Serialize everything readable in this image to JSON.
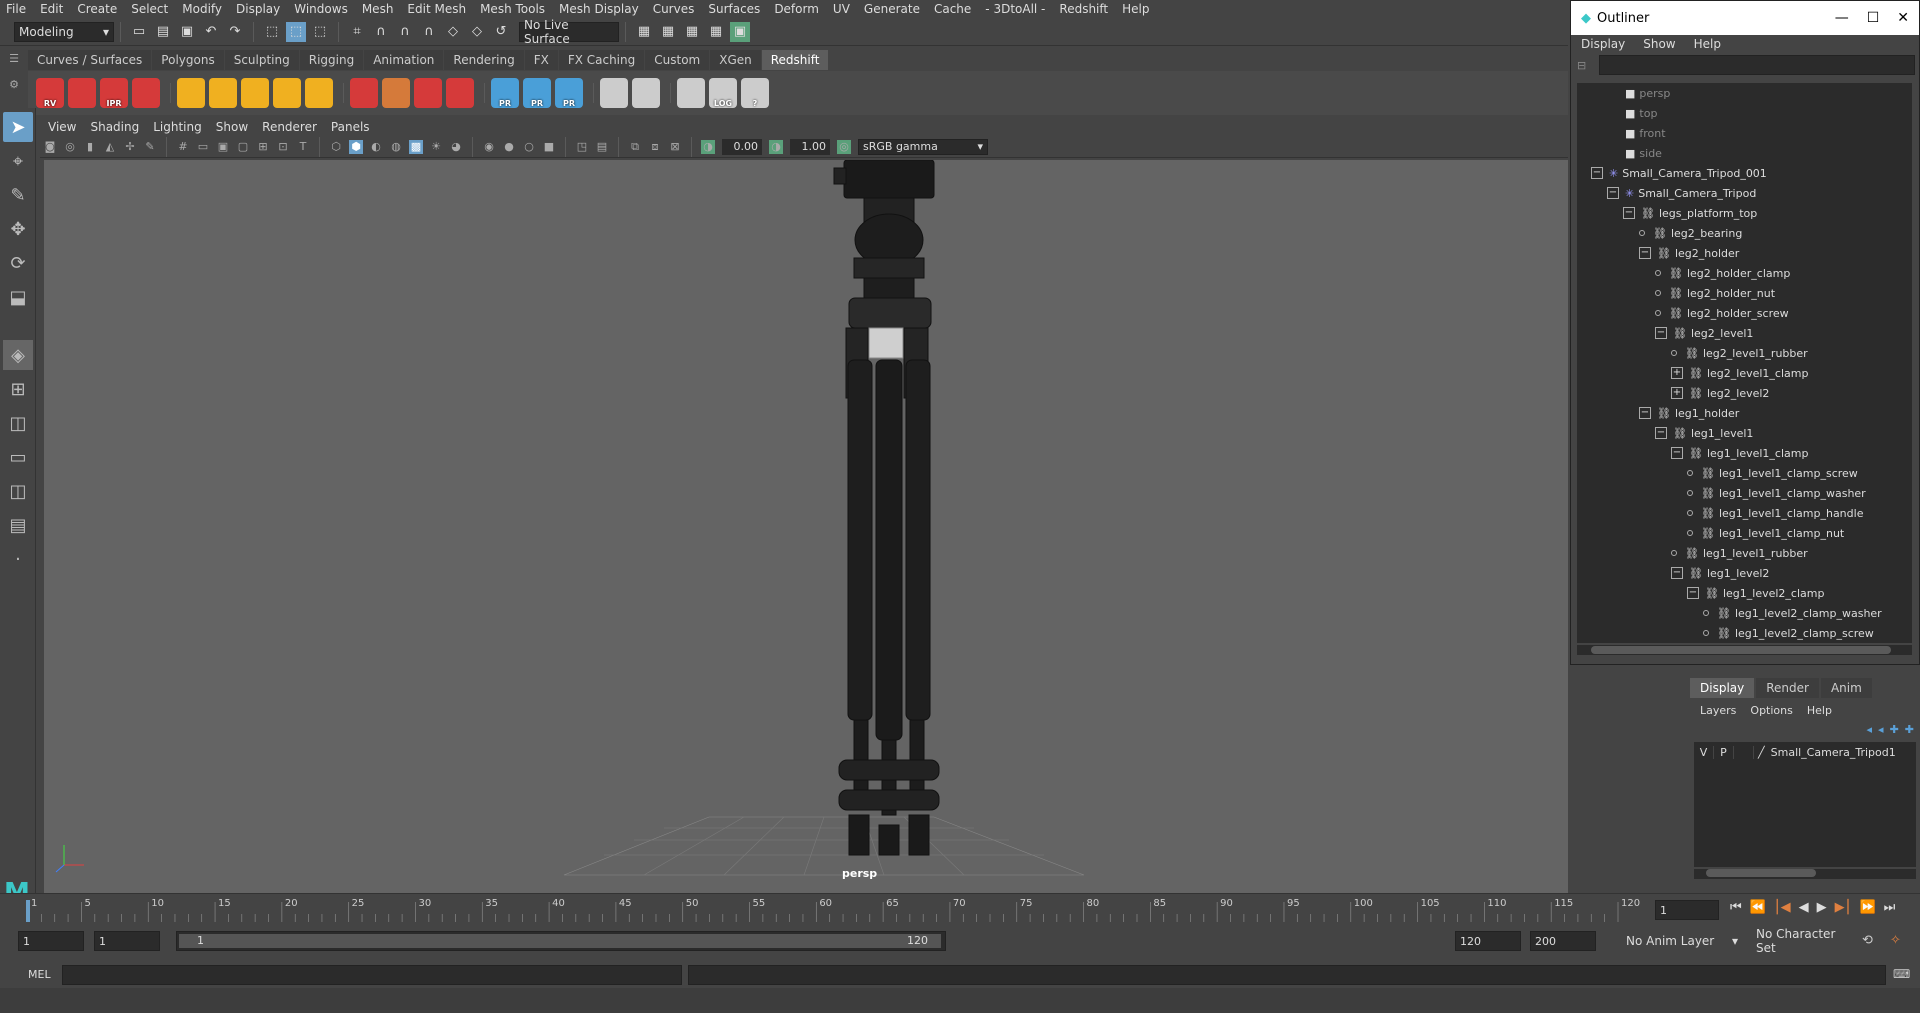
{
  "menubar": [
    "File",
    "Edit",
    "Create",
    "Select",
    "Modify",
    "Display",
    "Windows",
    "Mesh",
    "Edit Mesh",
    "Mesh Tools",
    "Mesh Display",
    "Curves",
    "Surfaces",
    "Deform",
    "UV",
    "Generate",
    "Cache",
    "- 3DtoAll -",
    "Redshift",
    "Help"
  ],
  "status": {
    "mode": "Modeling",
    "live_surface": "No Live Surface"
  },
  "shelf_tabs": [
    "Curves / Surfaces",
    "Polygons",
    "Sculpting",
    "Rigging",
    "Animation",
    "Rendering",
    "FX",
    "FX Caching",
    "Custom",
    "XGen",
    "Redshift"
  ],
  "shelf_active": "Redshift",
  "shelf_icons": [
    {
      "label": "RV",
      "color": "#d53a3a",
      "icon": "redshift-rv-icon"
    },
    {
      "label": "",
      "color": "#d53a3a",
      "icon": "redshift-cube-icon"
    },
    {
      "label": "IPR",
      "color": "#d53a3a",
      "icon": "redshift-ipr-icon"
    },
    {
      "label": "",
      "color": "#d53a3a",
      "icon": "redshift-settings-icon"
    },
    {
      "label": "",
      "color": "#f0b020",
      "icon": "light-plane-icon"
    },
    {
      "label": "",
      "color": "#f0b020",
      "icon": "light-quad-icon"
    },
    {
      "label": "",
      "color": "#f0b020",
      "icon": "light-spot-icon"
    },
    {
      "label": "",
      "color": "#f0b020",
      "icon": "light-dome-icon"
    },
    {
      "label": "",
      "color": "#f0b020",
      "icon": "light-sun-icon"
    },
    {
      "label": "",
      "color": "#d53a3a",
      "icon": "volume-icon"
    },
    {
      "label": "",
      "color": "#d57a3a",
      "icon": "hair-icon"
    },
    {
      "label": "",
      "color": "#d53a3a",
      "icon": "curve-icon"
    },
    {
      "label": "",
      "color": "#d53a3a",
      "icon": "material-ball-icon"
    },
    {
      "label": "PR",
      "color": "#4a9fd8",
      "icon": "proxy-icon"
    },
    {
      "label": "PR",
      "color": "#4a9fd8",
      "icon": "proxy-export-icon"
    },
    {
      "label": "PR",
      "color": "#4a9fd8",
      "icon": "proxy-convert-icon"
    },
    {
      "label": "",
      "color": "#cccccc",
      "icon": "bowl-icon"
    },
    {
      "label": "",
      "color": "#cccccc",
      "icon": "bowl2-icon"
    },
    {
      "label": "",
      "color": "#cccccc",
      "icon": "code-icon"
    },
    {
      "label": "LOG",
      "color": "#cccccc",
      "icon": "log-icon"
    },
    {
      "label": "?",
      "color": "#cccccc",
      "icon": "help-icon"
    }
  ],
  "panel_menu": [
    "View",
    "Shading",
    "Lighting",
    "Show",
    "Renderer",
    "Panels"
  ],
  "panel_bar": {
    "exposure": "0.00",
    "gamma": "1.00",
    "colorspace": "sRGB gamma"
  },
  "viewport": {
    "camera_label": "persp"
  },
  "outliner": {
    "title": "Outliner",
    "menu": [
      "Display",
      "Show",
      "Help"
    ],
    "rows": [
      {
        "label": "persp",
        "indent": 1,
        "type": "camera",
        "dim": true
      },
      {
        "label": "top",
        "indent": 1,
        "type": "camera",
        "dim": true
      },
      {
        "label": "front",
        "indent": 1,
        "type": "camera",
        "dim": true
      },
      {
        "label": "side",
        "indent": 1,
        "type": "camera",
        "dim": true
      },
      {
        "label": "Small_Camera_Tripod_001",
        "indent": 0,
        "type": "group",
        "exp": "-"
      },
      {
        "label": "Small_Camera_Tripod",
        "indent": 1,
        "type": "group",
        "exp": "-"
      },
      {
        "label": "legs_platform_top",
        "indent": 2,
        "type": "mesh",
        "exp": "-"
      },
      {
        "label": "leg2_bearing",
        "indent": 3,
        "type": "mesh"
      },
      {
        "label": "leg2_holder",
        "indent": 3,
        "type": "mesh",
        "exp": "-"
      },
      {
        "label": "leg2_holder_clamp",
        "indent": 4,
        "type": "mesh"
      },
      {
        "label": "leg2_holder_nut",
        "indent": 4,
        "type": "mesh"
      },
      {
        "label": "leg2_holder_screw",
        "indent": 4,
        "type": "mesh"
      },
      {
        "label": "leg2_level1",
        "indent": 4,
        "type": "mesh",
        "exp": "-"
      },
      {
        "label": "leg2_level1_rubber",
        "indent": 5,
        "type": "mesh"
      },
      {
        "label": "leg2_level1_clamp",
        "indent": 5,
        "type": "mesh",
        "exp": "+"
      },
      {
        "label": "leg2_level2",
        "indent": 5,
        "type": "mesh",
        "exp": "+"
      },
      {
        "label": "leg1_holder",
        "indent": 3,
        "type": "mesh",
        "exp": "-"
      },
      {
        "label": "leg1_level1",
        "indent": 4,
        "type": "mesh",
        "exp": "-"
      },
      {
        "label": "leg1_level1_clamp",
        "indent": 5,
        "type": "mesh",
        "exp": "-"
      },
      {
        "label": "leg1_level1_clamp_screw",
        "indent": 6,
        "type": "mesh"
      },
      {
        "label": "leg1_level1_clamp_washer",
        "indent": 6,
        "type": "mesh"
      },
      {
        "label": "leg1_level1_clamp_handle",
        "indent": 6,
        "type": "mesh"
      },
      {
        "label": "leg1_level1_clamp_nut",
        "indent": 6,
        "type": "mesh"
      },
      {
        "label": "leg1_level1_rubber",
        "indent": 5,
        "type": "mesh"
      },
      {
        "label": "leg1_level2",
        "indent": 5,
        "type": "mesh",
        "exp": "-"
      },
      {
        "label": "leg1_level2_clamp",
        "indent": 6,
        "type": "mesh",
        "exp": "-"
      },
      {
        "label": "leg1_level2_clamp_washer",
        "indent": 7,
        "type": "mesh"
      },
      {
        "label": "leg1_level2_clamp_screw",
        "indent": 7,
        "type": "mesh"
      }
    ]
  },
  "layers": {
    "tabs": [
      "Display",
      "Render",
      "Anim"
    ],
    "menu": [
      "Layers",
      "Options",
      "Help"
    ],
    "layer": {
      "v": "V",
      "p": "P",
      "name": "Small_Camera_Tripod1"
    }
  },
  "timeline": {
    "ticks": [
      "1",
      "5",
      "10",
      "15",
      "20",
      "25",
      "30",
      "35",
      "40",
      "45",
      "50",
      "55",
      "60",
      "65",
      "70",
      "75",
      "80",
      "85",
      "90",
      "95",
      "100",
      "105",
      "110",
      "115",
      "120"
    ],
    "current_frame": "1"
  },
  "range": {
    "start": "1",
    "start2": "1",
    "range_start": "1",
    "range_end": "120",
    "end": "120",
    "end2": "200",
    "anim_layer": "No Anim Layer",
    "char_set": "No Character Set"
  },
  "cmdline": {
    "label": "MEL"
  }
}
